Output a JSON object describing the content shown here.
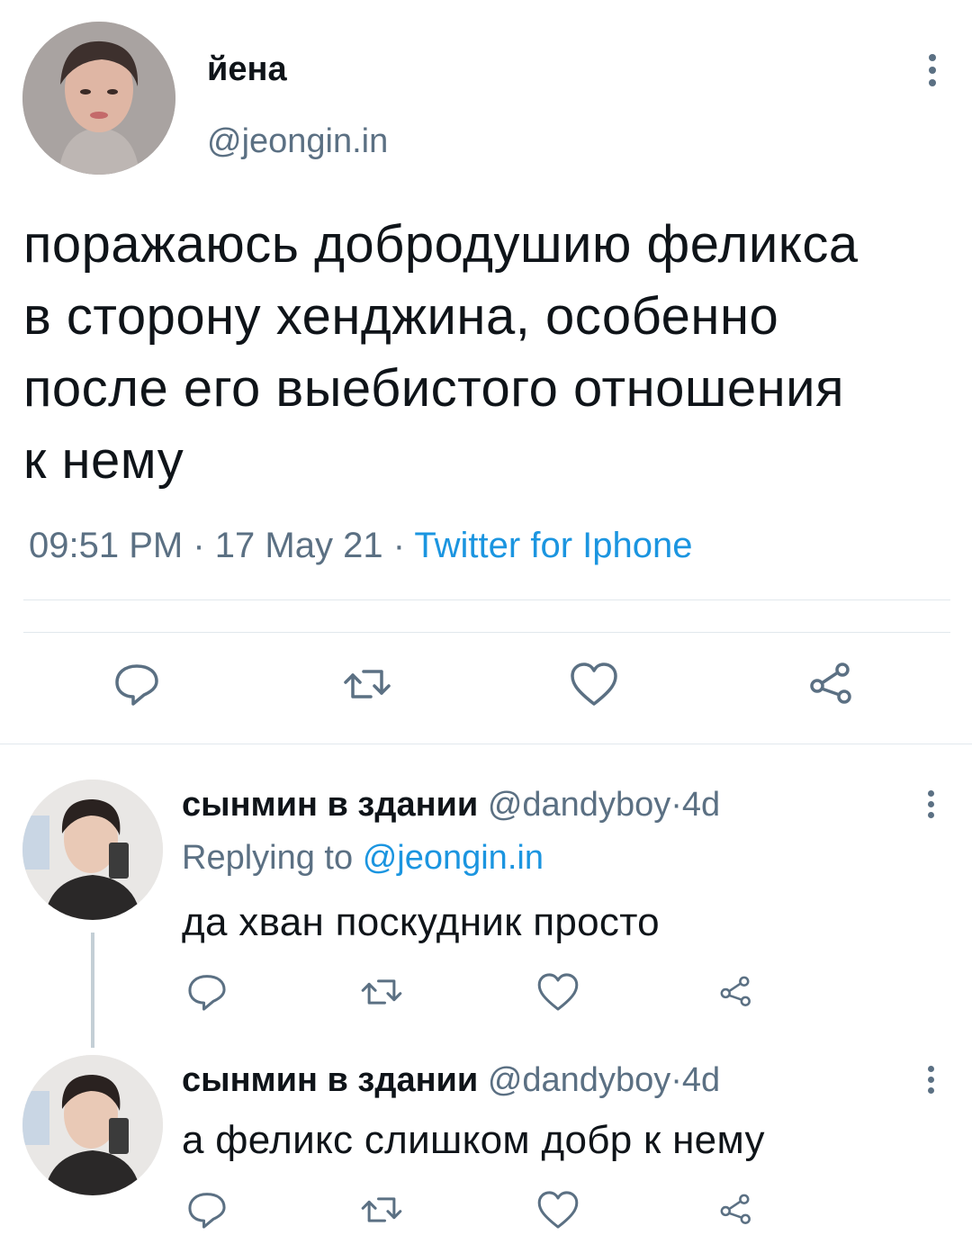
{
  "tweet": {
    "display_name": "йена",
    "handle": "@jeongin.in",
    "text_lines": [
      "поражаюсь добродушию феликса",
      "в сторону хенджина, особенно",
      "после его выебистого отношения",
      "к нему"
    ],
    "time": "09:51 PM",
    "date": "17 May 21",
    "separator": "·",
    "source": "Twitter for Iphone"
  },
  "actions": [
    "reply-icon",
    "retweet-icon",
    "like-icon",
    "share-icon"
  ],
  "replies": [
    {
      "display_name": "сынмин в здании",
      "handle": "@dandyboy",
      "separator": "·",
      "time": "4d",
      "replying_label": "Replying to",
      "replying_to": "@jeongin.in",
      "text": "да хван поскудник просто"
    },
    {
      "display_name": "сынмин в здании",
      "handle": "@dandyboy",
      "separator": "·",
      "time": "4d",
      "text": "а феликс слишком добр к нему"
    }
  ],
  "colors": {
    "text": "#0f1419",
    "secondary": "#5b7083",
    "link": "#1b95e0",
    "divider": "#e1e8ed"
  }
}
